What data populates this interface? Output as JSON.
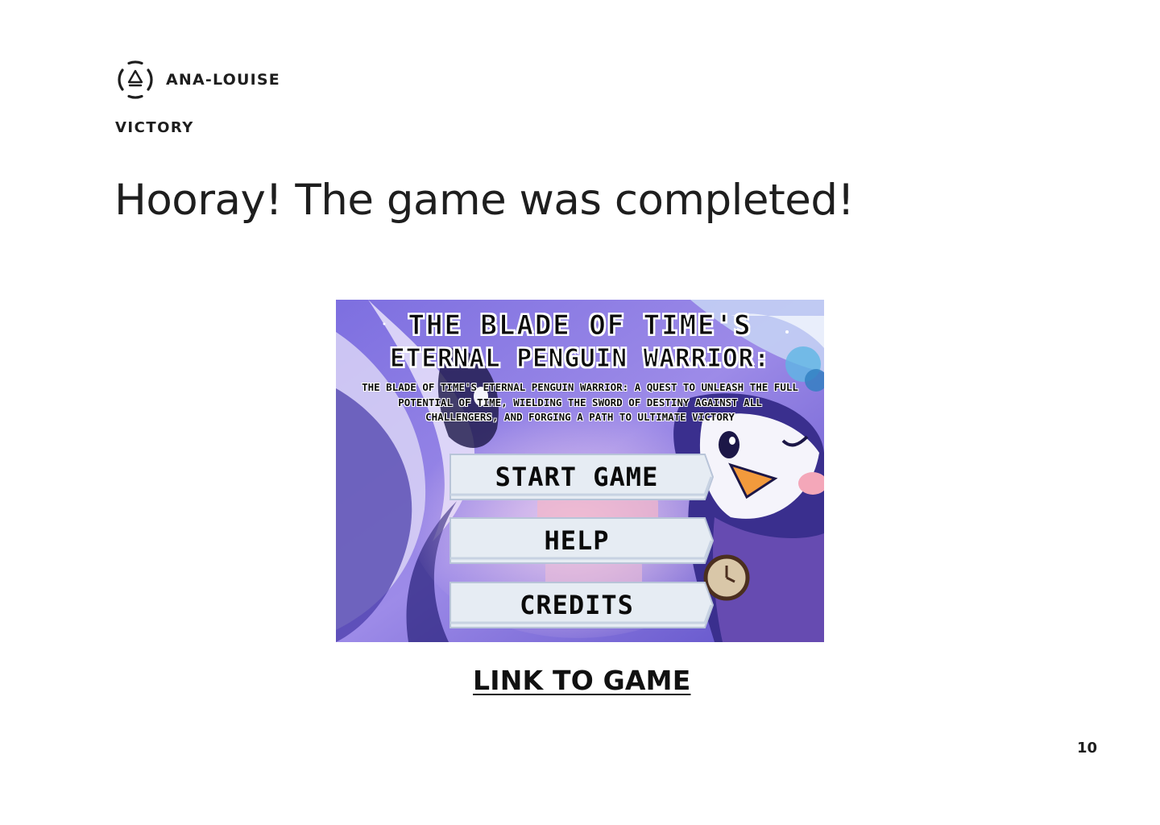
{
  "header": {
    "brand_name": "ANA-LOUISE",
    "logo_icon": "triangle-in-circle-logo-icon",
    "section_label": "VICTORY"
  },
  "main": {
    "title": "Hooray! The game was completed!",
    "link_label": "LINK TO GAME"
  },
  "game_screenshot": {
    "title_line1": "The Blade of Time's",
    "title_line2": "Eternal Penguin Warrior:",
    "subtitle": "The Blade of Time's Eternal Penguin Warrior: A Quest to Unleash the Full Potential of Time, Wielding the Sword of Destiny Against All Challengers, and Forging a Path to Ultimate Victory",
    "buttons": [
      {
        "label": "START GAME"
      },
      {
        "label": "HELP"
      },
      {
        "label": "CREDITS"
      }
    ],
    "colors": {
      "background_primary": "#6a5bd6",
      "background_secondary": "#b9a6ee",
      "button_fill": "#e6ecf3",
      "accent_orange": "#f29a3c",
      "accent_pink": "#f4a7b9"
    }
  },
  "footer": {
    "page_number": "10"
  }
}
